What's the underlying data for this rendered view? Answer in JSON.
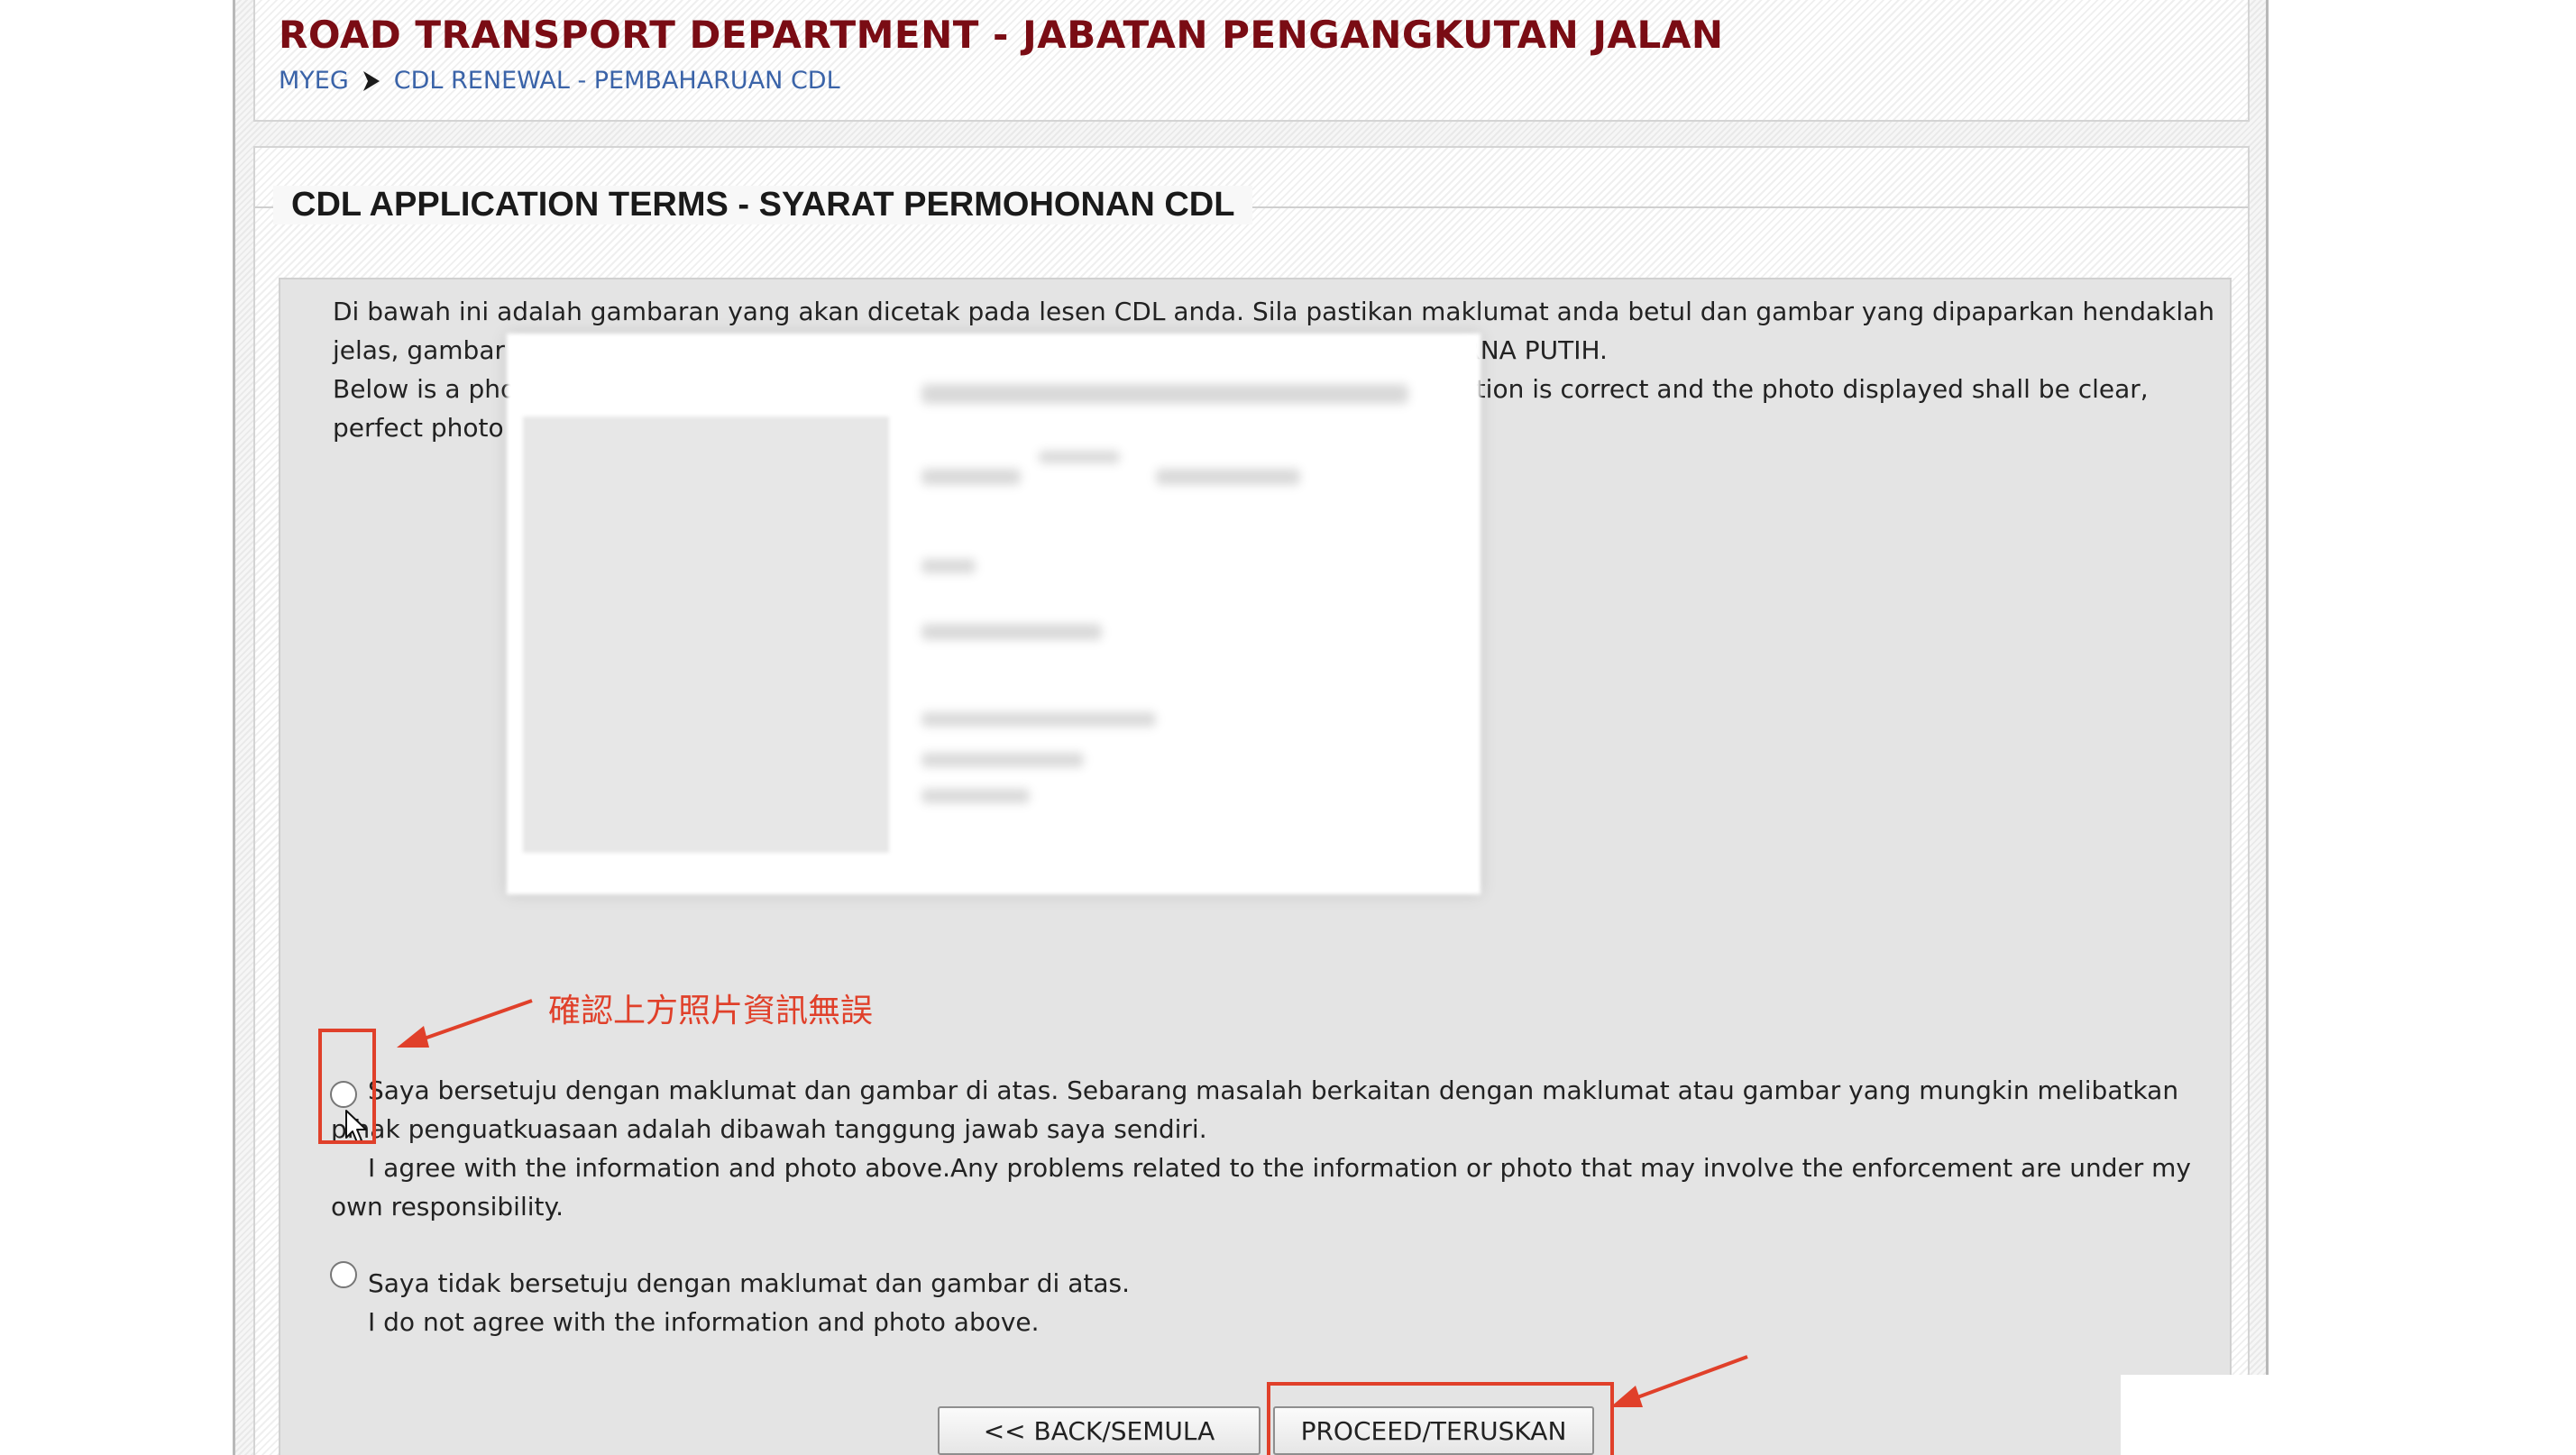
{
  "header": {
    "title": "ROAD TRANSPORT DEPARTMENT - JABATAN PENGANGKUTAN JALAN",
    "breadcrumb": [
      "MYEG",
      "CDL RENEWAL - PEMBAHARUAN CDL"
    ]
  },
  "panel": {
    "title": "CDL APPLICATION TERMS - SYARAT PERMOHONAN CDL",
    "instructions_ms": "Di bawah ini adalah gambaran yang akan dicetak pada lesen CDL anda. Sila pastikan maklumat anda betul dan gambar yang dipaparkan hendaklah jelas, gambar sempurna serta gambar yang dipaparkan adalah berlatar belakang BERWARNA PUTIH.",
    "instructions_en": "Below is a photo that will be printed on your CDL LICENCE. Please make sure your information is correct and the photo displayed shall be clear, perfect photo and the photo displayed is in white background."
  },
  "annotation": {
    "note": "確認上方照片資訊無誤"
  },
  "options": [
    {
      "text_ms": "Saya bersetuju dengan maklumat dan gambar di atas. Sebarang masalah berkaitan dengan maklumat atau gambar yang mungkin melibatkan pihak penguatkuasaan adalah dibawah tanggung jawab saya sendiri.",
      "text_en": "I agree with the information and photo above.Any problems related to the information or photo that may involve the enforcement are under my own responsibility.",
      "selected": false
    },
    {
      "text_ms": "Saya tidak bersetuju dengan maklumat dan gambar di atas.",
      "text_en": "I do not agree with the information and photo above.",
      "selected": false
    }
  ],
  "buttons": {
    "back": "<< BACK/SEMULA",
    "proceed": "PROCEED/TERUSKAN"
  },
  "colors": {
    "title": "#7a0c14",
    "link": "#3a63a8",
    "annotation": "#e0402a"
  }
}
